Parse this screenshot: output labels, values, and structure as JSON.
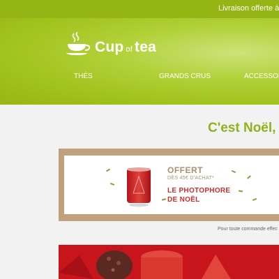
{
  "topbar": {
    "text": "Livraison offerte à pa"
  },
  "logo": {
    "cup": "Cup",
    "of": "of",
    "tea": "tea"
  },
  "nav": {
    "items": [
      "THÉS",
      "GRANDS CRUS",
      "ACCESSOIRE"
    ]
  },
  "banner": {
    "title": "C'est Noël, p"
  },
  "promo": {
    "offer": "OFFERT",
    "condition": "DÈS 45€ D'ACHAT*",
    "product_line1": "LE PHOTOPHORE",
    "product_line2": "DE NOËL"
  },
  "disclaimer": "Pour toute commande effec",
  "colors": {
    "brand_green": "#94b514",
    "title_green": "#8fb21a",
    "gold": "#bfa27d",
    "red": "#c8151c"
  }
}
